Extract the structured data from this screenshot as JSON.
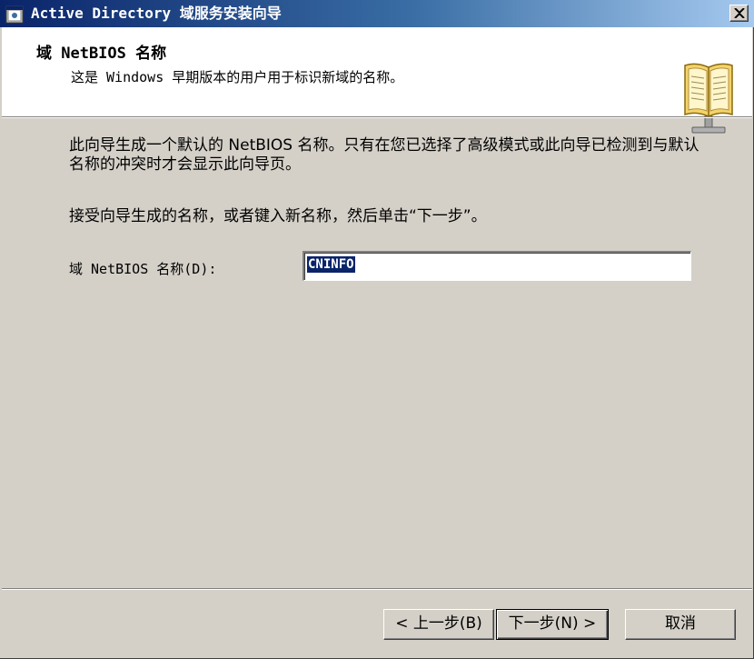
{
  "window": {
    "title": "Active Directory 域服务安装向导"
  },
  "header": {
    "title": "域 NetBIOS 名称",
    "subtitle": "这是 Windows 早期版本的用户用于标识新域的名称。",
    "icon": "book-icon"
  },
  "body": {
    "description": "此向导生成一个默认的 NetBIOS 名称。只有在您已选择了高级模式或此向导已检测到与默认名称的冲突时才会显示此向导页。",
    "instruction": "接受向导生成的名称，或者键入新名称，然后单击“下一步”。",
    "field_label": "域 NetBIOS 名称(D):",
    "field_value": "CNINFO"
  },
  "buttons": {
    "back": "< 上一步(B)",
    "next": "下一步(N) >",
    "cancel": "取消"
  },
  "colors": {
    "titlebar_start": "#0a246a",
    "titlebar_end": "#a6caf0",
    "dialog_bg": "#d4d0c8",
    "selection": "#0a246a"
  }
}
